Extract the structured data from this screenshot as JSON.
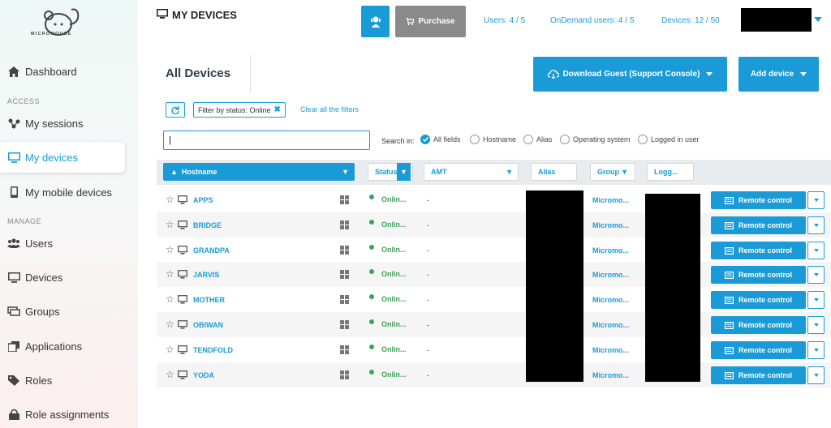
{
  "logo": {
    "text": "MICROMOUSE"
  },
  "sidebar": {
    "items": [
      {
        "label": "Dashboard",
        "icon": "home-icon"
      },
      {
        "section": "ACCESS"
      },
      {
        "label": "My sessions",
        "icon": "sessions-icon"
      },
      {
        "label": "My devices",
        "icon": "monitor-icon",
        "active": true
      },
      {
        "label": "My mobile devices",
        "icon": "mobile-icon"
      },
      {
        "section": "MANAGE"
      },
      {
        "label": "Users",
        "icon": "users-icon"
      },
      {
        "label": "Devices",
        "icon": "monitor-icon"
      },
      {
        "label": "Groups",
        "icon": "groups-icon"
      },
      {
        "label": "Applications",
        "icon": "applications-icon"
      },
      {
        "label": "Roles",
        "icon": "tag-icon"
      },
      {
        "label": "Role assignments",
        "icon": "lock-icon"
      }
    ]
  },
  "header": {
    "title": "MY DEVICES",
    "purchase_label": "Purchase",
    "stats": {
      "users": "Users: 4 / 5",
      "ondemand": "OnDemand users: 4 / 5",
      "devices": "Devices: 12 / 50"
    }
  },
  "main": {
    "section_title": "All Devices",
    "download_label": "Download Guest (Support Console)",
    "add_label": "Add device",
    "filter_chip": "Filter by status:  Online",
    "clear_filters": "Clear all the filters",
    "search": {
      "value": "|",
      "label": "Search in:"
    },
    "search_options": [
      "All fields",
      "Hostname",
      "Alias",
      "Operating system",
      "Logged in user"
    ],
    "columns": {
      "hostname": "Hostname",
      "status": "Status",
      "amt": "AMT",
      "alias": "Alias",
      "group": "Group",
      "logged": "Logg..."
    },
    "remote_label": "Remote control",
    "rows": [
      {
        "hostname": "APPS",
        "status": "Onlin...",
        "amt": "-",
        "group": "Micromo..."
      },
      {
        "hostname": "BRIDGE",
        "status": "Onlin...",
        "amt": "-",
        "group": "Micromo..."
      },
      {
        "hostname": "GRANDPA",
        "status": "Onlin...",
        "amt": "-",
        "group": "Micromo..."
      },
      {
        "hostname": "JARVIS",
        "status": "Onlin...",
        "amt": "-",
        "group": "Micromo..."
      },
      {
        "hostname": "MOTHER",
        "status": "Onlin...",
        "amt": "-",
        "group": "Micromo..."
      },
      {
        "hostname": "OBIWAN",
        "status": "Onlin...",
        "amt": "-",
        "group": "Micromo..."
      },
      {
        "hostname": "TENDFOLD",
        "status": "Onlin...",
        "amt": "-",
        "group": "Micromo..."
      },
      {
        "hostname": "YODA",
        "status": "Onlin...",
        "amt": "-",
        "group": "Micromo..."
      }
    ]
  },
  "colors": {
    "accent": "#1a9bd7",
    "online": "#3aa357",
    "purchase": "#8a8a8a"
  }
}
